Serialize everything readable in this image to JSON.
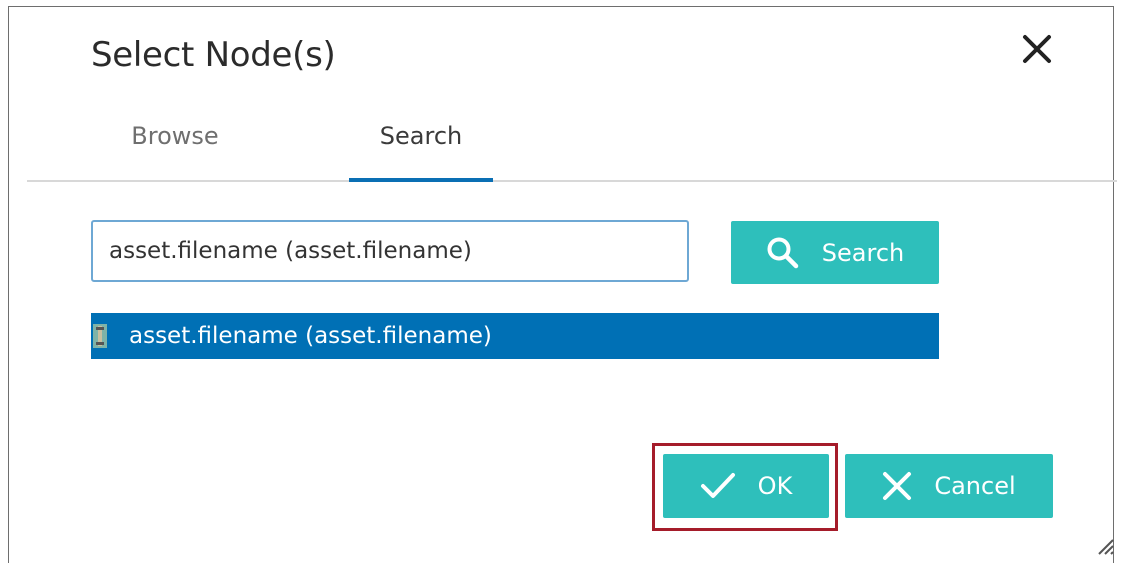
{
  "dialog": {
    "title": "Select Node(s)",
    "close_icon": "close-icon"
  },
  "tabs": [
    {
      "label": "Browse",
      "active": false
    },
    {
      "label": "Search",
      "active": true
    }
  ],
  "search": {
    "value": "asset.filename (asset.filename)",
    "button_label": "Search",
    "button_icon": "search-icon"
  },
  "results": [
    {
      "label": "asset.filename (asset.filename)",
      "icon": "node-variable-icon",
      "selected": true
    }
  ],
  "footer": {
    "ok_label": "OK",
    "ok_icon": "checkmark-icon",
    "cancel_label": "Cancel",
    "cancel_icon": "close-icon"
  },
  "colors": {
    "accent": "#2ebfbb",
    "selection": "#0070b5",
    "tab_underline": "#0a6fb4",
    "highlight_border": "#a51c2a"
  }
}
